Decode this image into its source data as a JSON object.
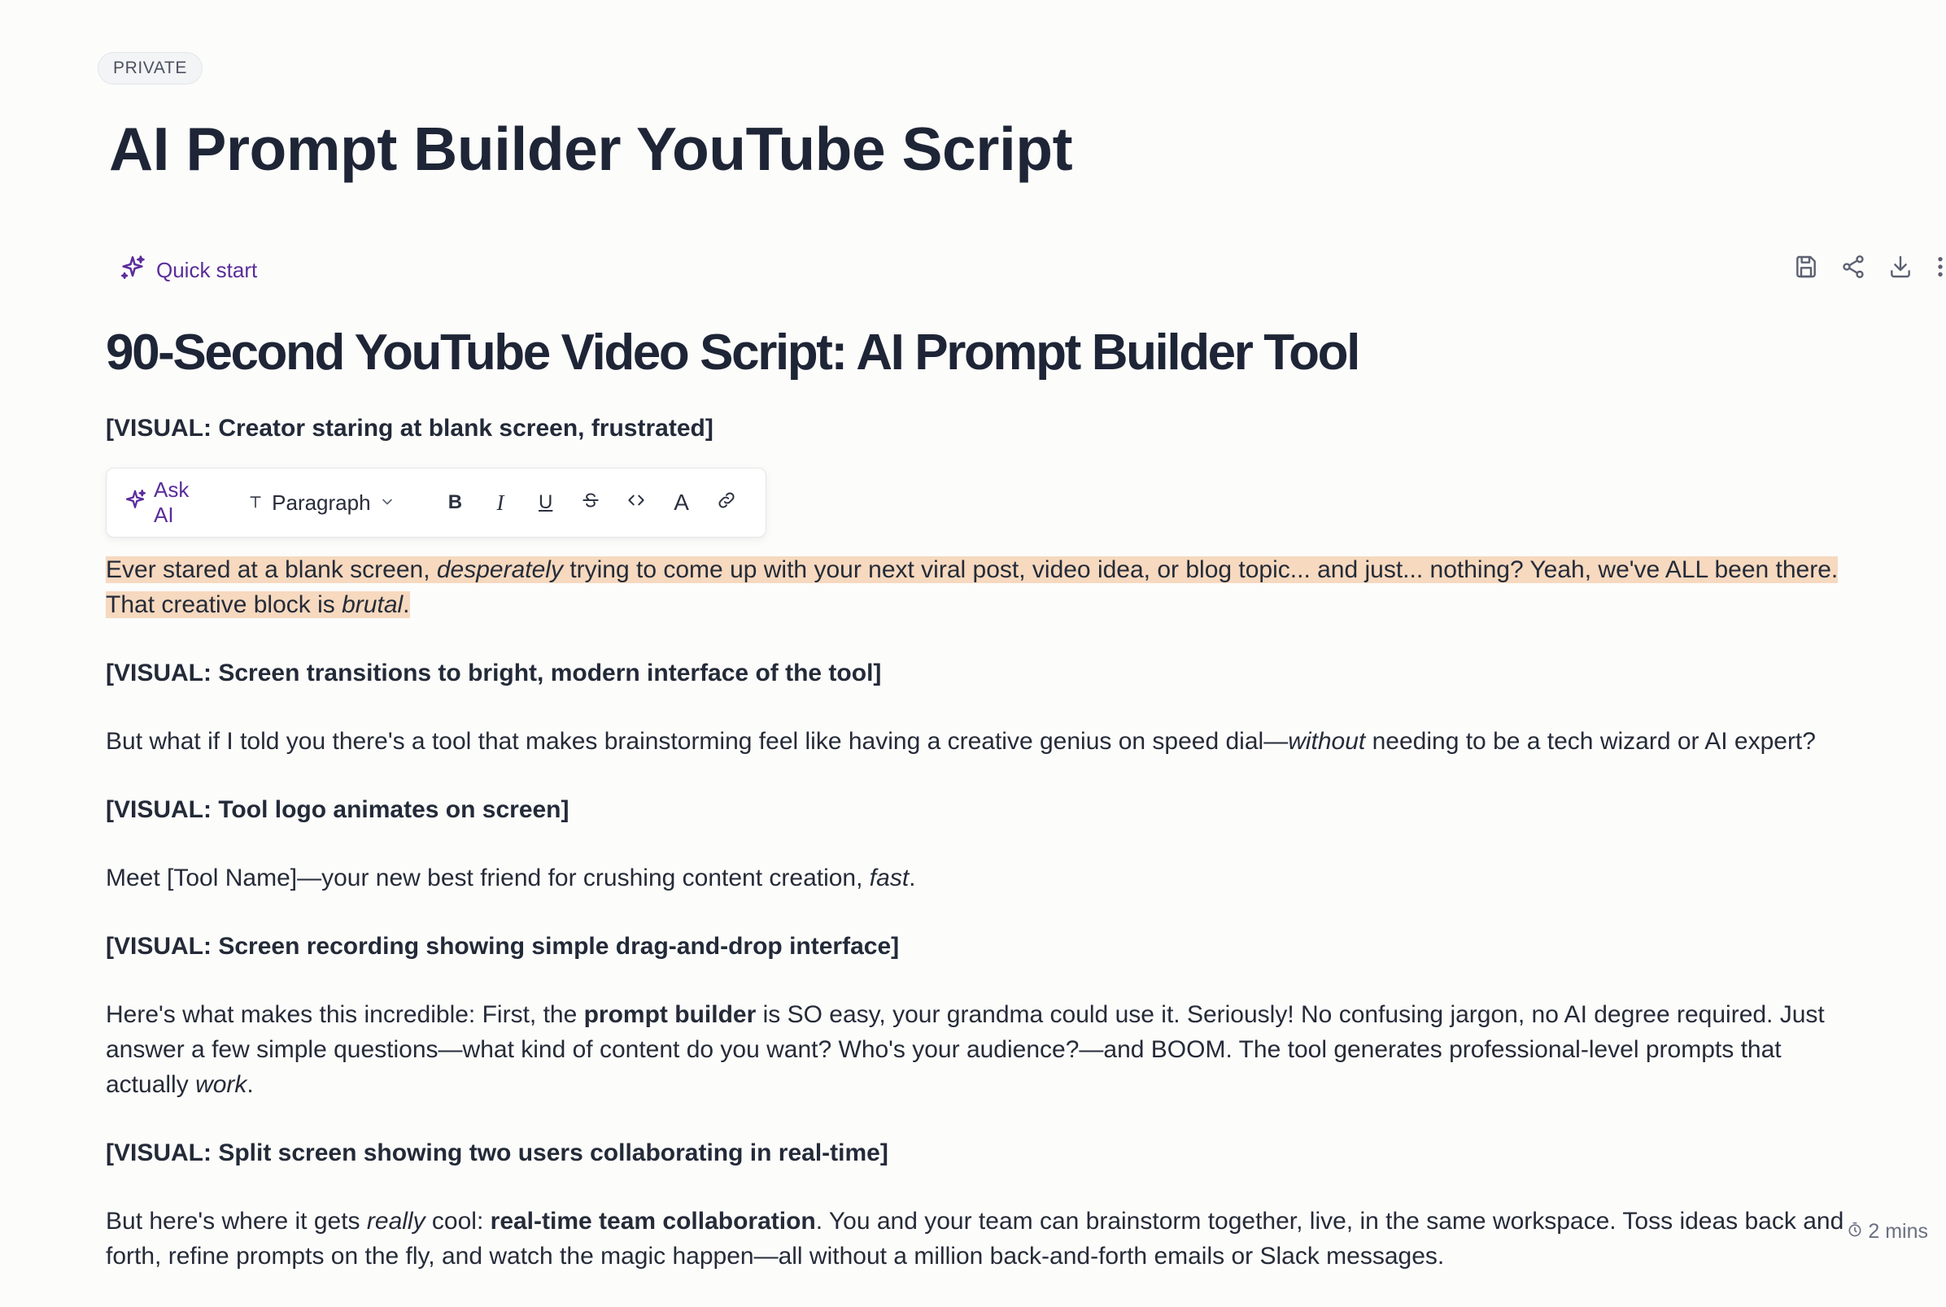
{
  "badge": "PRIVATE",
  "doc_title": "AI Prompt Builder YouTube Script",
  "quick_start": "Quick start",
  "content": {
    "heading": "90-Second YouTube Video Script: AI Prompt Builder Tool",
    "visual_1": "[VISUAL: Creator staring at blank screen, frustrated]",
    "para_1": {
      "a": "Ever stared at a blank screen, ",
      "b": "desperately",
      "c": " trying to come up with your next viral post, video idea, or blog topic... and just... nothing? Yeah, we've ALL been there. That creative block is ",
      "d": "brutal",
      "e": "."
    },
    "visual_2": "[VISUAL: Screen transitions to bright, modern interface of the tool]",
    "para_2": {
      "a": "But what if I told you there's a tool that makes brainstorming feel like having a creative genius on speed dial—",
      "b": "without",
      "c": " needing to be a tech wizard or AI expert?"
    },
    "visual_3": "[VISUAL: Tool logo animates on screen]",
    "para_3": {
      "a": "Meet [Tool Name]—your new best friend for crushing content creation, ",
      "b": "fast",
      "c": "."
    },
    "visual_4": "[VISUAL: Screen recording showing simple drag-and-drop interface]",
    "para_4": {
      "a": "Here's what makes this incredible: First, the ",
      "b": "prompt builder",
      "c": " is SO easy, your grandma could use it. Seriously! No confusing jargon, no AI degree required. Just answer a few simple questions—what kind of content do you want? Who's your audience?—and BOOM. The tool generates professional-level prompts that actually ",
      "d": "work",
      "e": "."
    },
    "visual_5": "[VISUAL: Split screen showing two users collaborating in real-time]",
    "para_5": {
      "a": "But here's where it gets ",
      "b": "really",
      "c": " cool: ",
      "d": "real-time team collaboration",
      "e": ". You and your team can brainstorm together, live, in the same workspace. Toss ideas back and forth, refine prompts on the fly, and watch the magic happen—all without a million back-and-forth emails or Slack messages."
    }
  },
  "toolbar": {
    "ask_ai": "Ask AI",
    "paragraph": "Paragraph",
    "bold": "B",
    "italic": "I",
    "underline": "U",
    "text_color": "A"
  },
  "read_time": "2 mins"
}
